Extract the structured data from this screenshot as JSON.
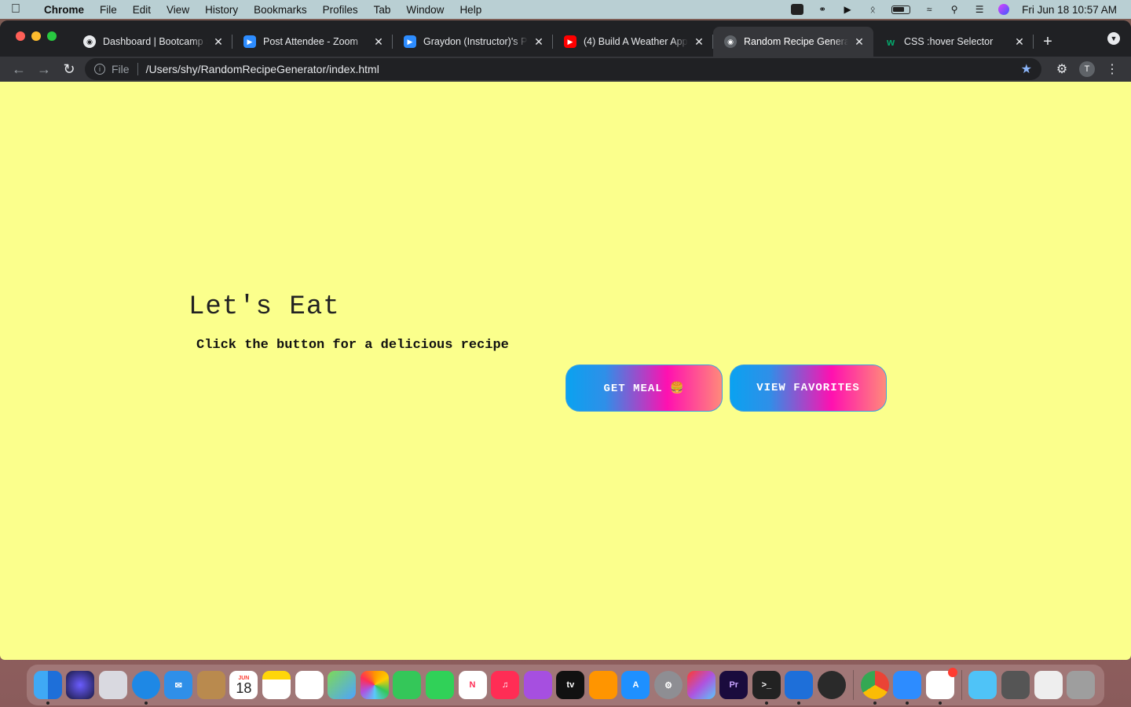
{
  "menubar": {
    "app": "Chrome",
    "items": [
      "File",
      "Edit",
      "View",
      "History",
      "Bookmarks",
      "Profiles",
      "Tab",
      "Window",
      "Help"
    ],
    "clock": "Fri Jun 18  10:57 AM"
  },
  "tabs": [
    {
      "title": "Dashboard | Bootcamp Spot",
      "favicon": "globe-icon",
      "active": false
    },
    {
      "title": "Post Attendee - Zoom",
      "favicon": "zoom-icon",
      "active": false
    },
    {
      "title": "Graydon (Instructor)'s Personal Meeting Room",
      "favicon": "zoom-icon",
      "active": false
    },
    {
      "title": "(4) Build A Weather App",
      "favicon": "youtube-icon",
      "active": false
    },
    {
      "title": "Random Recipe Generator",
      "favicon": "page-icon",
      "active": true
    },
    {
      "title": "CSS :hover Selector",
      "favicon": "w3schools-icon",
      "active": false
    }
  ],
  "omnibox": {
    "scheme": "File",
    "url": "/Users/shy/RandomRecipeGenerator/index.html"
  },
  "profile_initial": "T",
  "page": {
    "heading": "Let's Eat",
    "subheading": "Click the button for a delicious recipe",
    "get_meal_label": "GET MEAL 🍔",
    "view_favorites_label": "VIEW FAVORITES",
    "background_color": "#fbff8c"
  },
  "dock": {
    "calendar_month": "JUN",
    "calendar_day": "18"
  }
}
